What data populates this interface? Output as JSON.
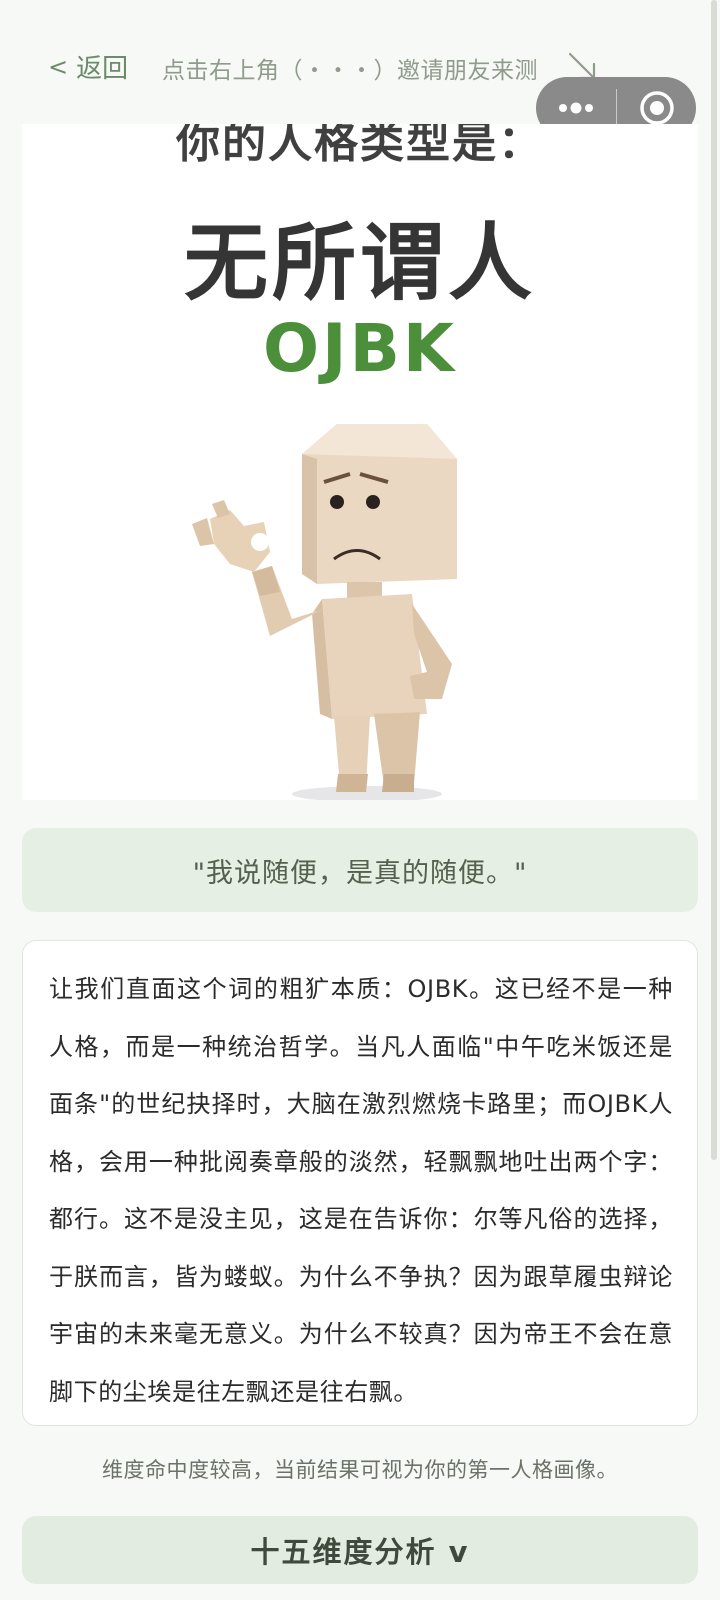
{
  "topbar": {
    "back_icon": "<",
    "back_label": "返回",
    "invite_text": "点击右上角（・・・）邀请朋友来测",
    "invite_arrow_icon": "arrow-down-right-icon"
  },
  "capsule": {
    "more_icon": "more-dots-icon",
    "close_icon": "target-circle-icon"
  },
  "result": {
    "pre_title": "你的人格类型是：",
    "name": "无所谓人",
    "code": "OJBK",
    "accent_color": "#4c8f3a"
  },
  "quote": "\"我说随便，是真的随便。\"",
  "description": "让我们直面这个词的粗犷本质：OJBK。这已经不是一种人格，而是一种统治哲学。当凡人面临\"中午吃米饭还是面条\"的世纪抉择时，大脑在激烈燃烧卡路里；而OJBK人格，会用一种批阅奏章般的淡然，轻飘飘地吐出两个字：都行。这不是没主见，这是在告诉你：尔等凡俗的选择，于朕而言，皆为蝼蚁。为什么不争执？因为跟草履虫辩论宇宙的未来毫无意义。为什么不较真？因为帝王不会在意脚下的尘埃是往左飘还是往右飘。",
  "note": "维度命中度较高，当前结果可视为你的第一人格画像。",
  "analysis_button": "十五维度分析 v"
}
